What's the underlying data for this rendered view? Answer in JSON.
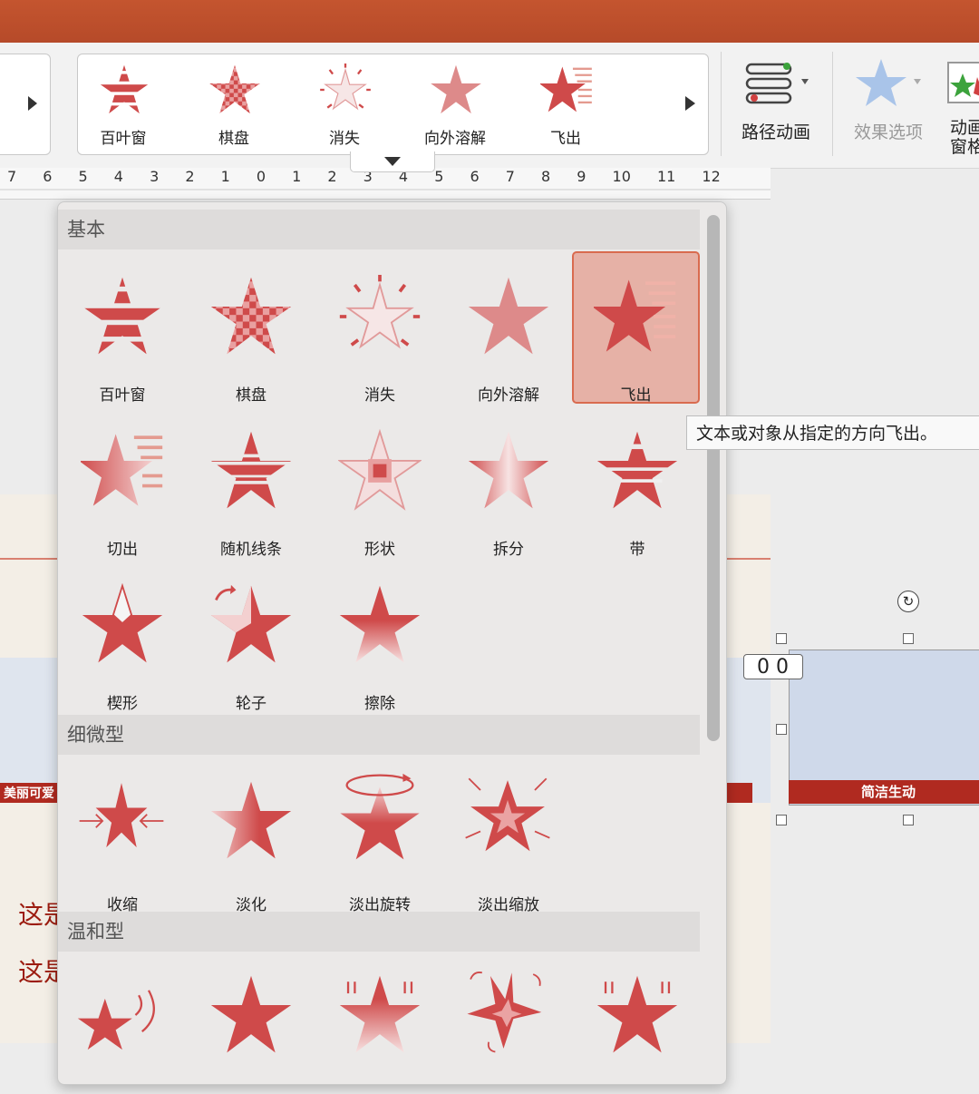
{
  "ribbon": {
    "gallery": [
      {
        "label": "百叶窗",
        "icon": "blinds-star-icon"
      },
      {
        "label": "棋盘",
        "icon": "checkerboard-star-icon"
      },
      {
        "label": "消失",
        "icon": "disappear-star-icon"
      },
      {
        "label": "向外溶解",
        "icon": "dissolve-out-star-icon"
      },
      {
        "label": "飞出",
        "icon": "fly-out-star-icon"
      }
    ],
    "path_animation": "路径动画",
    "effect_options": "效果选项",
    "animation_pane": "动画窗格"
  },
  "ruler": {
    "labels": "7 6 5 4 3 2 1 0 1 2 3 4 5 6 7 8 9 10 11 12"
  },
  "dropdown": {
    "sections": [
      {
        "title": "基本"
      },
      {
        "title": "细微型"
      },
      {
        "title": "温和型"
      }
    ],
    "basic": [
      {
        "label": "百叶窗",
        "icon": "blinds-star-icon"
      },
      {
        "label": "棋盘",
        "icon": "checkerboard-star-icon"
      },
      {
        "label": "消失",
        "icon": "disappear-star-icon"
      },
      {
        "label": "向外溶解",
        "icon": "dissolve-out-star-icon"
      },
      {
        "label": "飞出",
        "icon": "fly-out-star-icon",
        "selected": true
      },
      {
        "label": "切出",
        "icon": "peek-out-star-icon"
      },
      {
        "label": "随机线条",
        "icon": "random-bars-star-icon"
      },
      {
        "label": "形状",
        "icon": "shape-star-icon"
      },
      {
        "label": "拆分",
        "icon": "split-star-icon"
      },
      {
        "label": "带",
        "icon": "strips-star-icon"
      },
      {
        "label": "楔形",
        "icon": "wedge-star-icon"
      },
      {
        "label": "轮子",
        "icon": "wheel-star-icon"
      },
      {
        "label": "擦除",
        "icon": "wipe-star-icon"
      }
    ],
    "subtle": [
      {
        "label": "收缩",
        "icon": "shrink-star-icon"
      },
      {
        "label": "淡化",
        "icon": "fade-star-icon"
      },
      {
        "label": "淡出旋转",
        "icon": "fade-spin-star-icon"
      },
      {
        "label": "淡出缩放",
        "icon": "fade-zoom-star-icon"
      }
    ],
    "moderate": [
      {
        "icon": "boomerang-star-icon"
      },
      {
        "icon": "star-icon"
      },
      {
        "icon": "rise-star-icon"
      },
      {
        "icon": "spin-star-icon"
      },
      {
        "icon": "sink-star-icon"
      }
    ]
  },
  "tooltip": "文本或对象从指定的方向飞出。",
  "slide": {
    "banner": "美丽可爱",
    "line1": "这是",
    "line2": "这是",
    "thumb_bar": "简洁生动"
  },
  "counter": "0 0",
  "colors": {
    "accent": "#cf4a4a",
    "title_bar": "#b94d2a",
    "selected": "#e6b1a6"
  }
}
